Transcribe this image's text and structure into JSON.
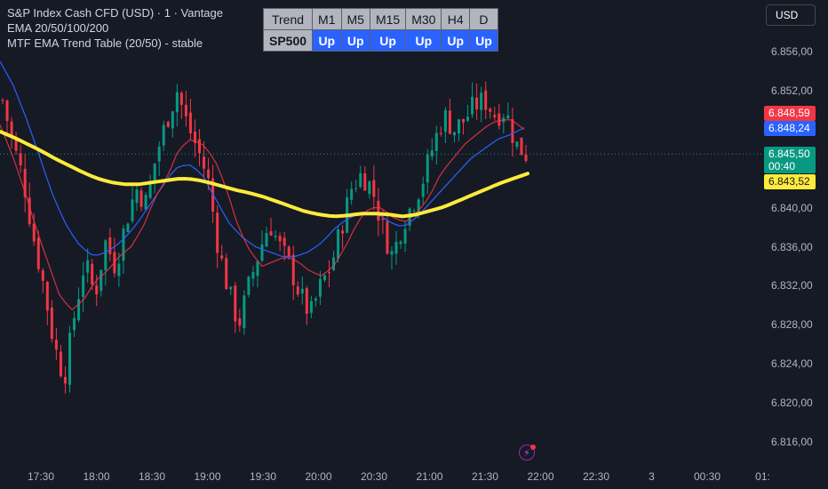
{
  "legend": {
    "symbol_line": "S&P Index Cash CFD (USD) · 1 · Vantage",
    "ema_line": "EMA 20/50/100/200",
    "table_line": "MTF EMA Trend Table (20/50) - stable"
  },
  "trend_table": {
    "header": [
      "Trend",
      "M1",
      "M5",
      "M15",
      "M30",
      "H4",
      "D"
    ],
    "row_label": "SP500",
    "row_values": [
      "Up",
      "Up",
      "Up",
      "Up",
      "Up",
      "Up"
    ]
  },
  "currency_button": "USD",
  "price_labels": {
    "red": "6.848,59",
    "blue": "6.848,24",
    "current": "6.845,50",
    "countdown": "00:40",
    "yellow": "6.843,52"
  },
  "colors": {
    "background": "#161a25",
    "up_candle": "#089981",
    "down_candle": "#f23645",
    "ema_red": "#f23645",
    "ema_blue": "#2962ff",
    "ema_yellow": "#ffeb3b"
  },
  "chart_data": {
    "type": "candlestick",
    "y_ticks": [
      "6.856,00",
      "6.852,00",
      "6.848,00",
      "6.844,00",
      "6.840,00",
      "6.836,00",
      "6.832,00",
      "6.828,00",
      "6.824,00",
      "6.820,00",
      "6.816,00"
    ],
    "x_ticks": [
      "17:30",
      "18:00",
      "18:30",
      "19:00",
      "19:30",
      "20:00",
      "20:30",
      "21:00",
      "21:30",
      "22:00",
      "22:30",
      "3",
      "00:30",
      "01:"
    ],
    "ylim": [
      6814.0,
      6858.0
    ],
    "close_path": [
      6851.0,
      6846.5,
      6843.0,
      6837.0,
      6832.0,
      6826.0,
      6822.5,
      6829.0,
      6834.5,
      6831.0,
      6836.5,
      6834.0,
      6838.5,
      6842.0,
      6840.5,
      6845.5,
      6849.0,
      6852.0,
      6848.5,
      6846.0,
      6843.0,
      6836.0,
      6831.5,
      6828.0,
      6832.0,
      6835.5,
      6838.5,
      6836.0,
      6834.0,
      6831.0,
      6829.0,
      6832.0,
      6834.0,
      6838.0,
      6842.0,
      6843.5,
      6842.0,
      6838.0,
      6835.0,
      6838.5,
      6840.5,
      6843.0,
      6846.5,
      6849.5,
      6848.0,
      6849.0,
      6850.5,
      6851.0,
      6849.5,
      6850.0,
      6846.5,
      6845.5
    ],
    "ema_red": [
      6848.5,
      6845.5,
      6842.0,
      6838.0,
      6834.5,
      6831.0,
      6829.5,
      6830.5,
      6832.5,
      6833.5,
      6835.0,
      6836.0,
      6838.0,
      6841.0,
      6843.0,
      6846.0,
      6847.0,
      6846.5,
      6845.0,
      6842.0,
      6838.0,
      6835.5,
      6834.0,
      6834.5,
      6835.0,
      6834.5,
      6833.5,
      6833.0,
      6834.0,
      6836.0,
      6838.5,
      6840.0,
      6840.0,
      6839.0,
      6838.5,
      6839.5,
      6841.0,
      6843.5,
      6845.0,
      6846.5,
      6847.5,
      6848.5,
      6849.0,
      6849.0,
      6848.0
    ],
    "ema_blue": [
      6855.0,
      6852.5,
      6849.0,
      6845.0,
      6841.0,
      6838.0,
      6836.0,
      6835.0,
      6835.5,
      6836.5,
      6838.0,
      6840.0,
      6842.0,
      6844.0,
      6844.5,
      6843.5,
      6841.0,
      6838.5,
      6837.0,
      6836.0,
      6835.5,
      6835.0,
      6835.0,
      6835.5,
      6836.5,
      6838.0,
      6839.0,
      6839.5,
      6839.5,
      6838.5,
      6838.0,
      6839.0,
      6840.5,
      6842.0,
      6843.5,
      6845.0,
      6846.0,
      6847.0,
      6847.5,
      6848.2
    ],
    "ema_yellow": [
      6847.8,
      6847.2,
      6846.5,
      6845.8,
      6845.0,
      6844.3,
      6843.6,
      6843.0,
      6842.6,
      6842.4,
      6842.4,
      6842.6,
      6842.8,
      6843.0,
      6842.9,
      6842.6,
      6842.2,
      6841.8,
      6841.5,
      6841.1,
      6840.6,
      6840.1,
      6839.6,
      6839.3,
      6839.1,
      6839.2,
      6839.4,
      6839.4,
      6839.3,
      6839.1,
      6839.3,
      6839.7,
      6840.1,
      6840.7,
      6841.3,
      6841.9,
      6842.5,
      6843.0,
      6843.5
    ]
  }
}
